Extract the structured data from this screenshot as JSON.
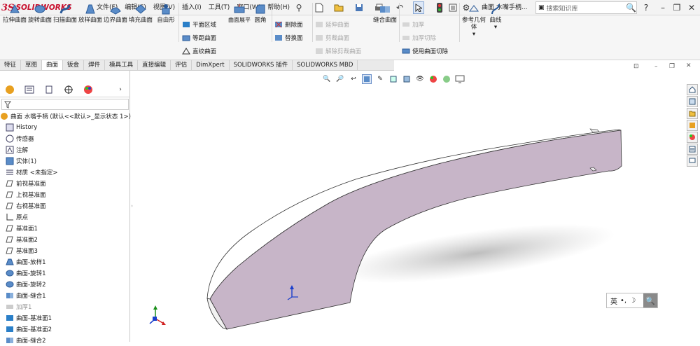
{
  "app": {
    "logo_ds": "3S",
    "logo_text": "SOLIDWORKS",
    "doc_title": "曲面 水嘴手柄..."
  },
  "menus": [
    "文件(F)",
    "编辑(E)",
    "视图(V)",
    "插入(I)",
    "工具(T)",
    "窗口(W)",
    "帮助(H)"
  ],
  "search": {
    "placeholder": "搜索知识库"
  },
  "ribbon": {
    "big": [
      "拉伸曲面",
      "旋转曲面",
      "扫描曲面",
      "放样曲面",
      "边界曲面",
      "填充曲面",
      "自由形"
    ],
    "g2": [
      "平面区域",
      "等距曲面",
      "直纹曲面"
    ],
    "g2b": "曲面展平",
    "g2c": "圆角",
    "g3": [
      "删除面",
      "替换面"
    ],
    "g4": [
      "延伸曲面",
      "剪裁曲面",
      "解除剪裁曲面"
    ],
    "g4b": "缝合曲面",
    "g5": [
      "加厚",
      "加厚切除",
      "使用曲面切除"
    ],
    "g6": [
      "参考几何体",
      "曲线"
    ]
  },
  "tabs": [
    "特征",
    "草图",
    "曲面",
    "钣金",
    "焊件",
    "模具工具",
    "直接编辑",
    "评估",
    "DimXpert",
    "SOLIDWORKS 插件",
    "SOLIDWORKS MBD"
  ],
  "active_tab": "曲面",
  "tree": {
    "root": "曲面 水嘴手柄 (默认<<默认>_显示状态 1>)",
    "items": [
      "History",
      "传感器",
      "注解",
      "实体(1)",
      "材质 <未指定>",
      "前视基准面",
      "上视基准面",
      "右视基准面",
      "原点",
      "基准面1",
      "基准面2",
      "基准面3",
      "曲面-放样1",
      "曲面-旋转1",
      "曲面-旋转2",
      "曲面-缝合1",
      "加厚1",
      "曲面-基准面1",
      "曲面-基准面2",
      "曲面-缝合2"
    ]
  },
  "ime": {
    "label": "英"
  },
  "colors": {
    "face": "#c7b5c8",
    "logo": "#c8102e",
    "axis_y": "#1a3fcc",
    "axis_x": "#d02020",
    "axis_z": "#1a8f1a"
  }
}
